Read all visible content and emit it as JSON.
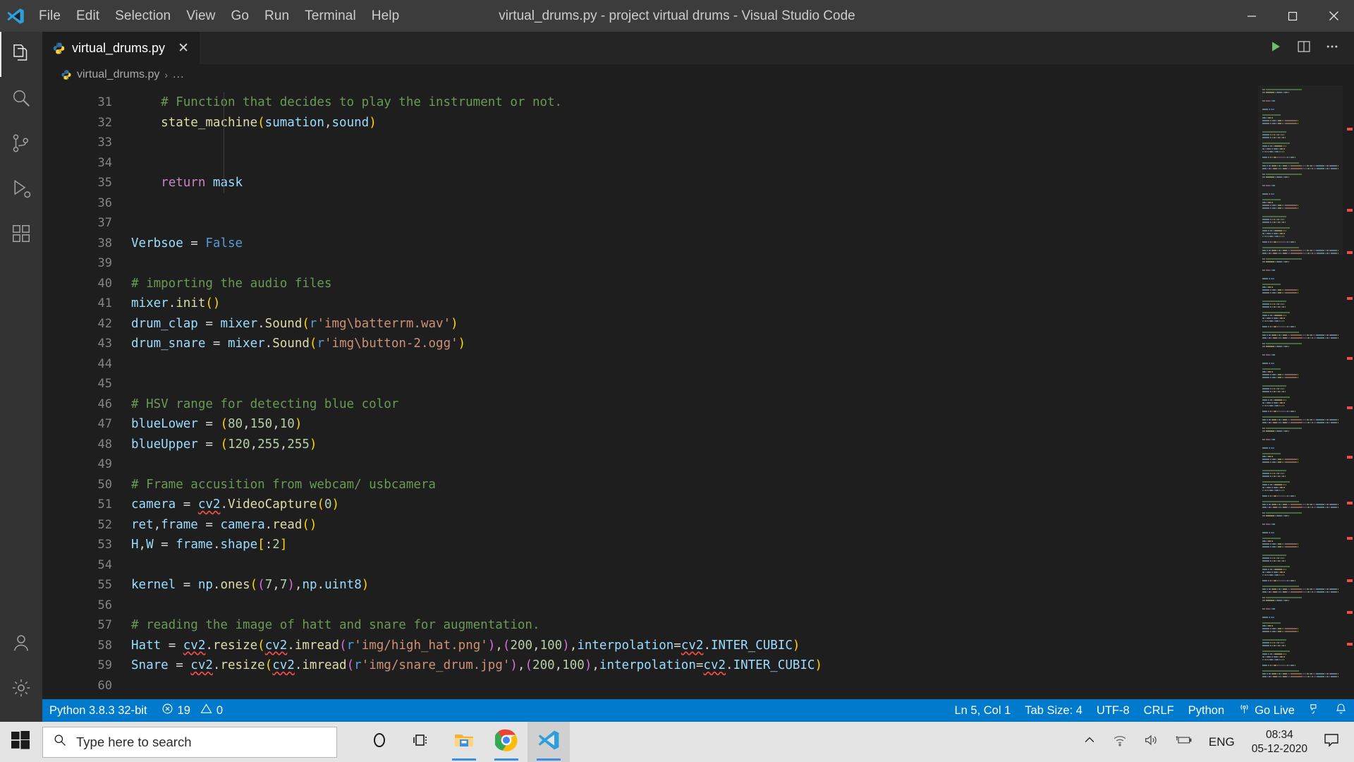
{
  "titlebar": {
    "logo_icon": "vscode-logo-icon",
    "menu": [
      "File",
      "Edit",
      "Selection",
      "View",
      "Go",
      "Run",
      "Terminal",
      "Help"
    ],
    "title": "virtual_drums.py - project virtual drums - Visual Studio Code",
    "window_controls": [
      "minimize",
      "maximize",
      "close"
    ]
  },
  "activitybar": {
    "items": [
      {
        "name": "explorer",
        "icon": "files-icon",
        "active": true
      },
      {
        "name": "search",
        "icon": "search-icon",
        "active": false
      },
      {
        "name": "source-control",
        "icon": "source-control-icon",
        "active": false
      },
      {
        "name": "run-and-debug",
        "icon": "run-debug-icon",
        "active": false
      },
      {
        "name": "extensions",
        "icon": "extensions-icon",
        "active": false
      }
    ],
    "bottom": [
      {
        "name": "accounts",
        "icon": "account-icon"
      },
      {
        "name": "manage",
        "icon": "gear-icon"
      }
    ]
  },
  "tabs": {
    "open": [
      {
        "label": "virtual_drums.py",
        "icon": "python-file-icon",
        "close": "✕",
        "active": true
      }
    ],
    "actions": [
      {
        "name": "run-python-file",
        "icon": "play-icon",
        "color": "#6ac16a"
      },
      {
        "name": "split-editor",
        "icon": "split-editor-icon"
      },
      {
        "name": "more-actions",
        "icon": "ellipsis-icon"
      }
    ]
  },
  "breadcrumbs": {
    "file": "virtual_drums.py",
    "separator": "›",
    "dots": "..."
  },
  "editor": {
    "first_visible_partial_line": "30",
    "lines": [
      {
        "n": "31",
        "indent": true,
        "tokens": [
          {
            "t": "    ",
            "c": "t-plain"
          },
          {
            "t": "# Function that decides to play the instrument or not.",
            "c": "t-comment"
          }
        ]
      },
      {
        "n": "32",
        "indent": true,
        "tokens": [
          {
            "t": "    ",
            "c": "t-plain"
          },
          {
            "t": "state_machine",
            "c": "t-func"
          },
          {
            "t": "(",
            "c": "t-par1"
          },
          {
            "t": "sumation",
            "c": "t-var"
          },
          {
            "t": ",",
            "c": "t-plain"
          },
          {
            "t": "sound",
            "c": "t-var"
          },
          {
            "t": ")",
            "c": "t-par1"
          }
        ]
      },
      {
        "n": "33",
        "indent": true,
        "tokens": []
      },
      {
        "n": "34",
        "indent": true,
        "tokens": []
      },
      {
        "n": "35",
        "indent": true,
        "tokens": [
          {
            "t": "    ",
            "c": "t-plain"
          },
          {
            "t": "return",
            "c": "t-keyword"
          },
          {
            "t": " ",
            "c": "t-plain"
          },
          {
            "t": "mask",
            "c": "t-var"
          }
        ]
      },
      {
        "n": "36",
        "indent": false,
        "tokens": []
      },
      {
        "n": "37",
        "indent": false,
        "tokens": []
      },
      {
        "n": "38",
        "indent": false,
        "tokens": [
          {
            "t": "Verbsoe ",
            "c": "t-var"
          },
          {
            "t": "= ",
            "c": "t-plain"
          },
          {
            "t": "False",
            "c": "t-const"
          }
        ]
      },
      {
        "n": "39",
        "indent": false,
        "tokens": []
      },
      {
        "n": "40",
        "indent": false,
        "tokens": [
          {
            "t": "# importing the audio files",
            "c": "t-comment"
          }
        ]
      },
      {
        "n": "41",
        "indent": false,
        "tokens": [
          {
            "t": "mixer",
            "c": "t-var"
          },
          {
            "t": ".",
            "c": "t-plain"
          },
          {
            "t": "init",
            "c": "t-func"
          },
          {
            "t": "()",
            "c": "t-par1"
          }
        ]
      },
      {
        "n": "42",
        "indent": false,
        "tokens": [
          {
            "t": "drum_clap ",
            "c": "t-var"
          },
          {
            "t": "= ",
            "c": "t-plain"
          },
          {
            "t": "mixer",
            "c": "t-var"
          },
          {
            "t": ".",
            "c": "t-plain"
          },
          {
            "t": "Sound",
            "c": "t-func"
          },
          {
            "t": "(",
            "c": "t-par1"
          },
          {
            "t": "r",
            "c": "t-strpfx"
          },
          {
            "t": "'img\\batterrm.wav'",
            "c": "t-str"
          },
          {
            "t": ")",
            "c": "t-par1"
          }
        ]
      },
      {
        "n": "43",
        "indent": false,
        "tokens": [
          {
            "t": "drum_snare ",
            "c": "t-var"
          },
          {
            "t": "= ",
            "c": "t-plain"
          },
          {
            "t": "mixer",
            "c": "t-var"
          },
          {
            "t": ".",
            "c": "t-plain"
          },
          {
            "t": "Sound",
            "c": "t-func"
          },
          {
            "t": "(",
            "c": "t-par1"
          },
          {
            "t": "r",
            "c": "t-strpfx"
          },
          {
            "t": "'img\\button-2.ogg'",
            "c": "t-str"
          },
          {
            "t": ")",
            "c": "t-par1"
          }
        ]
      },
      {
        "n": "44",
        "indent": false,
        "tokens": []
      },
      {
        "n": "45",
        "indent": false,
        "tokens": []
      },
      {
        "n": "46",
        "indent": false,
        "tokens": [
          {
            "t": "# HSV range for detecting blue color",
            "c": "t-comment"
          }
        ]
      },
      {
        "n": "47",
        "indent": false,
        "tokens": [
          {
            "t": "blueLower ",
            "c": "t-var"
          },
          {
            "t": "= ",
            "c": "t-plain"
          },
          {
            "t": "(",
            "c": "t-par1"
          },
          {
            "t": "80",
            "c": "t-num"
          },
          {
            "t": ",",
            "c": "t-plain"
          },
          {
            "t": "150",
            "c": "t-num"
          },
          {
            "t": ",",
            "c": "t-plain"
          },
          {
            "t": "10",
            "c": "t-num"
          },
          {
            "t": ")",
            "c": "t-par1"
          }
        ]
      },
      {
        "n": "48",
        "indent": false,
        "tokens": [
          {
            "t": "blueUpper ",
            "c": "t-var"
          },
          {
            "t": "= ",
            "c": "t-plain"
          },
          {
            "t": "(",
            "c": "t-par1"
          },
          {
            "t": "120",
            "c": "t-num"
          },
          {
            "t": ",",
            "c": "t-plain"
          },
          {
            "t": "255",
            "c": "t-num"
          },
          {
            "t": ",",
            "c": "t-plain"
          },
          {
            "t": "255",
            "c": "t-num"
          },
          {
            "t": ")",
            "c": "t-par1"
          }
        ]
      },
      {
        "n": "49",
        "indent": false,
        "tokens": []
      },
      {
        "n": "50",
        "indent": false,
        "tokens": [
          {
            "t": "# Frame accusition from webcam/ usbcamera",
            "c": "t-comment"
          }
        ]
      },
      {
        "n": "51",
        "indent": false,
        "tokens": [
          {
            "t": "camera ",
            "c": "t-var"
          },
          {
            "t": "= ",
            "c": "t-plain"
          },
          {
            "t": "cv2",
            "c": "t-var squiggle"
          },
          {
            "t": ".",
            "c": "t-plain"
          },
          {
            "t": "VideoCapture",
            "c": "t-func"
          },
          {
            "t": "(",
            "c": "t-par1"
          },
          {
            "t": "0",
            "c": "t-num"
          },
          {
            "t": ")",
            "c": "t-par1"
          }
        ]
      },
      {
        "n": "52",
        "indent": false,
        "tokens": [
          {
            "t": "ret",
            "c": "t-var"
          },
          {
            "t": ",",
            "c": "t-plain"
          },
          {
            "t": "frame ",
            "c": "t-var"
          },
          {
            "t": "= ",
            "c": "t-plain"
          },
          {
            "t": "camera",
            "c": "t-var"
          },
          {
            "t": ".",
            "c": "t-plain"
          },
          {
            "t": "read",
            "c": "t-func"
          },
          {
            "t": "()",
            "c": "t-par1"
          }
        ]
      },
      {
        "n": "53",
        "indent": false,
        "tokens": [
          {
            "t": "H",
            "c": "t-var"
          },
          {
            "t": ",",
            "c": "t-plain"
          },
          {
            "t": "W ",
            "c": "t-var"
          },
          {
            "t": "= ",
            "c": "t-plain"
          },
          {
            "t": "frame",
            "c": "t-var"
          },
          {
            "t": ".",
            "c": "t-plain"
          },
          {
            "t": "shape",
            "c": "t-var"
          },
          {
            "t": "[",
            "c": "t-par1"
          },
          {
            "t": ":",
            "c": "t-plain"
          },
          {
            "t": "2",
            "c": "t-num"
          },
          {
            "t": "]",
            "c": "t-par1"
          }
        ]
      },
      {
        "n": "54",
        "indent": false,
        "tokens": []
      },
      {
        "n": "55",
        "indent": false,
        "tokens": [
          {
            "t": "kernel ",
            "c": "t-var"
          },
          {
            "t": "= ",
            "c": "t-plain"
          },
          {
            "t": "np",
            "c": "t-var"
          },
          {
            "t": ".",
            "c": "t-plain"
          },
          {
            "t": "ones",
            "c": "t-func"
          },
          {
            "t": "(",
            "c": "t-par1"
          },
          {
            "t": "(",
            "c": "t-par2"
          },
          {
            "t": "7",
            "c": "t-num"
          },
          {
            "t": ",",
            "c": "t-plain"
          },
          {
            "t": "7",
            "c": "t-num"
          },
          {
            "t": ")",
            "c": "t-par2"
          },
          {
            "t": ",",
            "c": "t-plain"
          },
          {
            "t": "np",
            "c": "t-var"
          },
          {
            "t": ".",
            "c": "t-plain"
          },
          {
            "t": "uint8",
            "c": "t-var"
          },
          {
            "t": ")",
            "c": "t-par1"
          }
        ]
      },
      {
        "n": "56",
        "indent": false,
        "tokens": []
      },
      {
        "n": "57",
        "indent": false,
        "tokens": [
          {
            "t": "# reading the image of hatt and snare for augmentation.",
            "c": "t-comment"
          }
        ]
      },
      {
        "n": "58",
        "indent": false,
        "tokens": [
          {
            "t": "Hatt ",
            "c": "t-var"
          },
          {
            "t": "= ",
            "c": "t-plain"
          },
          {
            "t": "cv2",
            "c": "t-var squiggle"
          },
          {
            "t": ".",
            "c": "t-plain"
          },
          {
            "t": "resize",
            "c": "t-func"
          },
          {
            "t": "(",
            "c": "t-par1"
          },
          {
            "t": "cv2",
            "c": "t-var squiggle"
          },
          {
            "t": ".",
            "c": "t-plain"
          },
          {
            "t": "imread",
            "c": "t-func"
          },
          {
            "t": "(",
            "c": "t-par2"
          },
          {
            "t": "r",
            "c": "t-strpfx"
          },
          {
            "t": "'img/high_hat.png'",
            "c": "t-str"
          },
          {
            "t": ")",
            "c": "t-par2"
          },
          {
            "t": ",",
            "c": "t-plain"
          },
          {
            "t": "(",
            "c": "t-par2"
          },
          {
            "t": "200",
            "c": "t-num"
          },
          {
            "t": ",",
            "c": "t-plain"
          },
          {
            "t": "100",
            "c": "t-num"
          },
          {
            "t": ")",
            "c": "t-par2"
          },
          {
            "t": ",",
            "c": "t-plain"
          },
          {
            "t": "interpolation",
            "c": "t-var"
          },
          {
            "t": "=",
            "c": "t-plain"
          },
          {
            "t": "cv2",
            "c": "t-var squiggle"
          },
          {
            "t": ".",
            "c": "t-plain"
          },
          {
            "t": "INTER_CUBIC",
            "c": "t-var"
          },
          {
            "t": ")",
            "c": "t-par1"
          }
        ]
      },
      {
        "n": "59",
        "indent": false,
        "tokens": [
          {
            "t": "Snare ",
            "c": "t-var"
          },
          {
            "t": "= ",
            "c": "t-plain"
          },
          {
            "t": "cv2",
            "c": "t-var squiggle"
          },
          {
            "t": ".",
            "c": "t-plain"
          },
          {
            "t": "resize",
            "c": "t-func"
          },
          {
            "t": "(",
            "c": "t-par1"
          },
          {
            "t": "cv2",
            "c": "t-var squiggle"
          },
          {
            "t": ".",
            "c": "t-plain"
          },
          {
            "t": "imread",
            "c": "t-func"
          },
          {
            "t": "(",
            "c": "t-par2"
          },
          {
            "t": "r",
            "c": "t-strpfx"
          },
          {
            "t": "'img/snare_drum.jpg'",
            "c": "t-str"
          },
          {
            "t": ")",
            "c": "t-par2"
          },
          {
            "t": ",",
            "c": "t-plain"
          },
          {
            "t": "(",
            "c": "t-par2"
          },
          {
            "t": "200",
            "c": "t-num"
          },
          {
            "t": ",",
            "c": "t-plain"
          },
          {
            "t": "100",
            "c": "t-num"
          },
          {
            "t": ")",
            "c": "t-par2"
          },
          {
            "t": ",",
            "c": "t-plain"
          },
          {
            "t": "interpolation",
            "c": "t-var"
          },
          {
            "t": "=",
            "c": "t-plain"
          },
          {
            "t": "cv2",
            "c": "t-var squiggle"
          },
          {
            "t": ".",
            "c": "t-plain"
          },
          {
            "t": "INTER_CUBIC",
            "c": "t-var"
          },
          {
            "t": ")",
            "c": "t-par1"
          }
        ]
      },
      {
        "n": "60",
        "indent": false,
        "tokens": []
      }
    ]
  },
  "statusbar": {
    "left": [
      {
        "name": "python-interpreter",
        "label": "Python 3.8.3 32-bit",
        "icon": null
      },
      {
        "name": "problems",
        "label": "19",
        "icon": "error-icon",
        "label2": "0",
        "icon2": "warning-icon"
      }
    ],
    "errors_count": "19",
    "warnings_count": "0",
    "right": [
      {
        "name": "cursor-position",
        "label": "Ln 5, Col 1"
      },
      {
        "name": "tab-size",
        "label": "Tab Size: 4"
      },
      {
        "name": "encoding",
        "label": "UTF-8"
      },
      {
        "name": "eol",
        "label": "CRLF"
      },
      {
        "name": "language-mode",
        "label": "Python"
      },
      {
        "name": "go-live",
        "label": "Go Live",
        "icon": "broadcast-icon"
      },
      {
        "name": "live-share",
        "label": "",
        "icon": "live-share-icon"
      },
      {
        "name": "notifications",
        "label": "",
        "icon": "bell-icon"
      }
    ],
    "background": "#007acc"
  },
  "taskbar": {
    "start_icon": "windows-start-icon",
    "search_placeholder": "Type here to search",
    "search_icon": "search-icon",
    "icons": [
      {
        "name": "cortana-icon",
        "running": false
      },
      {
        "name": "task-view-icon",
        "running": false
      },
      {
        "name": "file-explorer-icon",
        "running": true
      },
      {
        "name": "google-chrome-icon",
        "running": true
      },
      {
        "name": "visual-studio-code-icon",
        "running": true,
        "active": true
      }
    ],
    "tray": [
      {
        "name": "show-hidden-icons",
        "icon": "chevron-up-icon"
      },
      {
        "name": "network-icon",
        "icon": "wifi-icon"
      },
      {
        "name": "volume-icon",
        "icon": "speaker-icon"
      },
      {
        "name": "battery-icon",
        "icon": "battery-charging-icon"
      }
    ],
    "language": "ENG",
    "time": "08:34",
    "date": "05-12-2020",
    "action_center_icon": "notification-icon"
  }
}
